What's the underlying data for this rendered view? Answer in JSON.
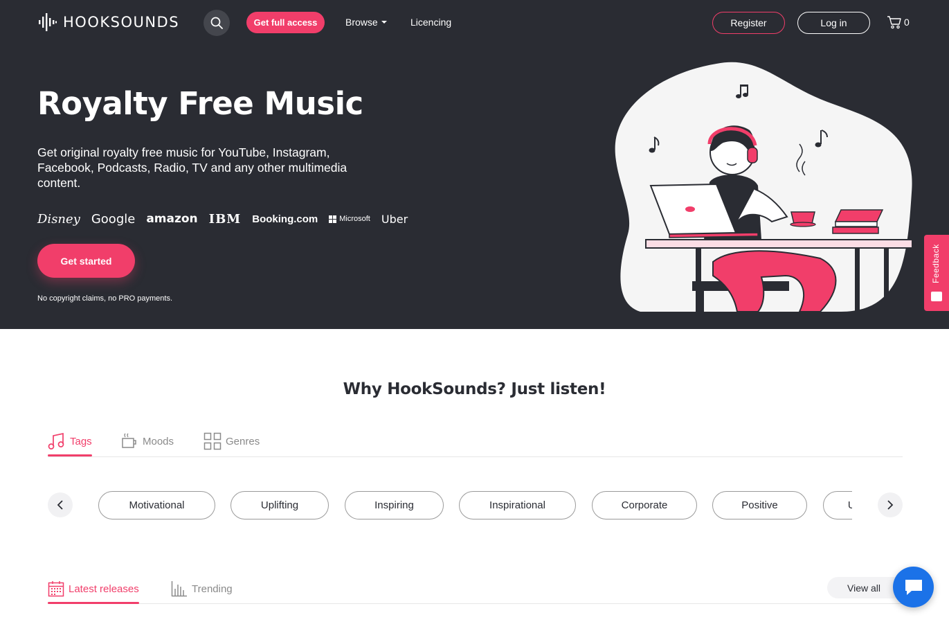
{
  "header": {
    "logo_text": "HOOKSOUNDS",
    "search_icon": "search-icon",
    "get_access_label": "Get full access",
    "browse_label": "Browse",
    "licencing_label": "Licencing",
    "register_label": "Register",
    "login_label": "Log in",
    "cart_count": "0"
  },
  "hero": {
    "title": "Royalty Free Music",
    "description": "Get original royalty free music for YouTube, Instagram, Facebook, Podcasts, Radio, TV and any other multimedia content.",
    "brands": [
      "Disney",
      "Google",
      "amazon",
      "IBM",
      "Booking.com",
      "Microsoft",
      "Uber"
    ],
    "cta_label": "Get started",
    "note": "No copyright claims, no PRO payments."
  },
  "feedback": {
    "label": "Feedback"
  },
  "why": {
    "title": "Why HookSounds? Just listen!",
    "tabs": [
      {
        "label": "Tags",
        "icon": "music-note-icon",
        "active": true
      },
      {
        "label": "Moods",
        "icon": "coffee-cup-icon",
        "active": false
      },
      {
        "label": "Genres",
        "icon": "grid-icon",
        "active": false
      }
    ],
    "tags": [
      "Motivational",
      "Uplifting",
      "Inspiring",
      "Inspirational",
      "Corporate",
      "Positive",
      "Upbeat"
    ]
  },
  "releases": {
    "tabs": [
      {
        "label": "Latest releases",
        "icon": "calendar-icon",
        "active": true
      },
      {
        "label": "Trending",
        "icon": "bar-chart-icon",
        "active": false
      }
    ],
    "view_all_label": "View all"
  },
  "colors": {
    "hero_bg": "#2a2c33",
    "accent": "#f13e6a",
    "chat": "#1b72e8"
  }
}
